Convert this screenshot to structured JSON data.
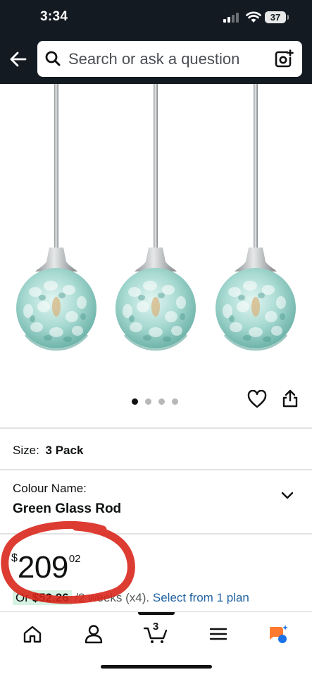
{
  "status_bar": {
    "time": "3:34",
    "battery": "37"
  },
  "search": {
    "placeholder": "Search or ask a question"
  },
  "gallery": {
    "image_count": 4,
    "active_index": 0,
    "glass_color": "#9ed7cf"
  },
  "product": {
    "size_label": "Size:",
    "size_value": "3 Pack",
    "colour_label": "Colour Name:",
    "colour_value": "Green Glass Rod"
  },
  "price": {
    "currency": "$",
    "whole": "209",
    "fraction": "02",
    "installment_prefix": "Or ",
    "installment_amount": "$52.26",
    "installment_terms": " /2 weeks (x4). ",
    "installment_link": "Select from 1 plan"
  },
  "nav": {
    "cart_count": "3"
  },
  "colors": {
    "header_bg": "#131a22",
    "link": "#2162a1",
    "highlight": "#d6f2e2",
    "annotation": "#d9271c",
    "assistant": "#ff7a2e",
    "assistant_accent": "#1a73e8"
  }
}
